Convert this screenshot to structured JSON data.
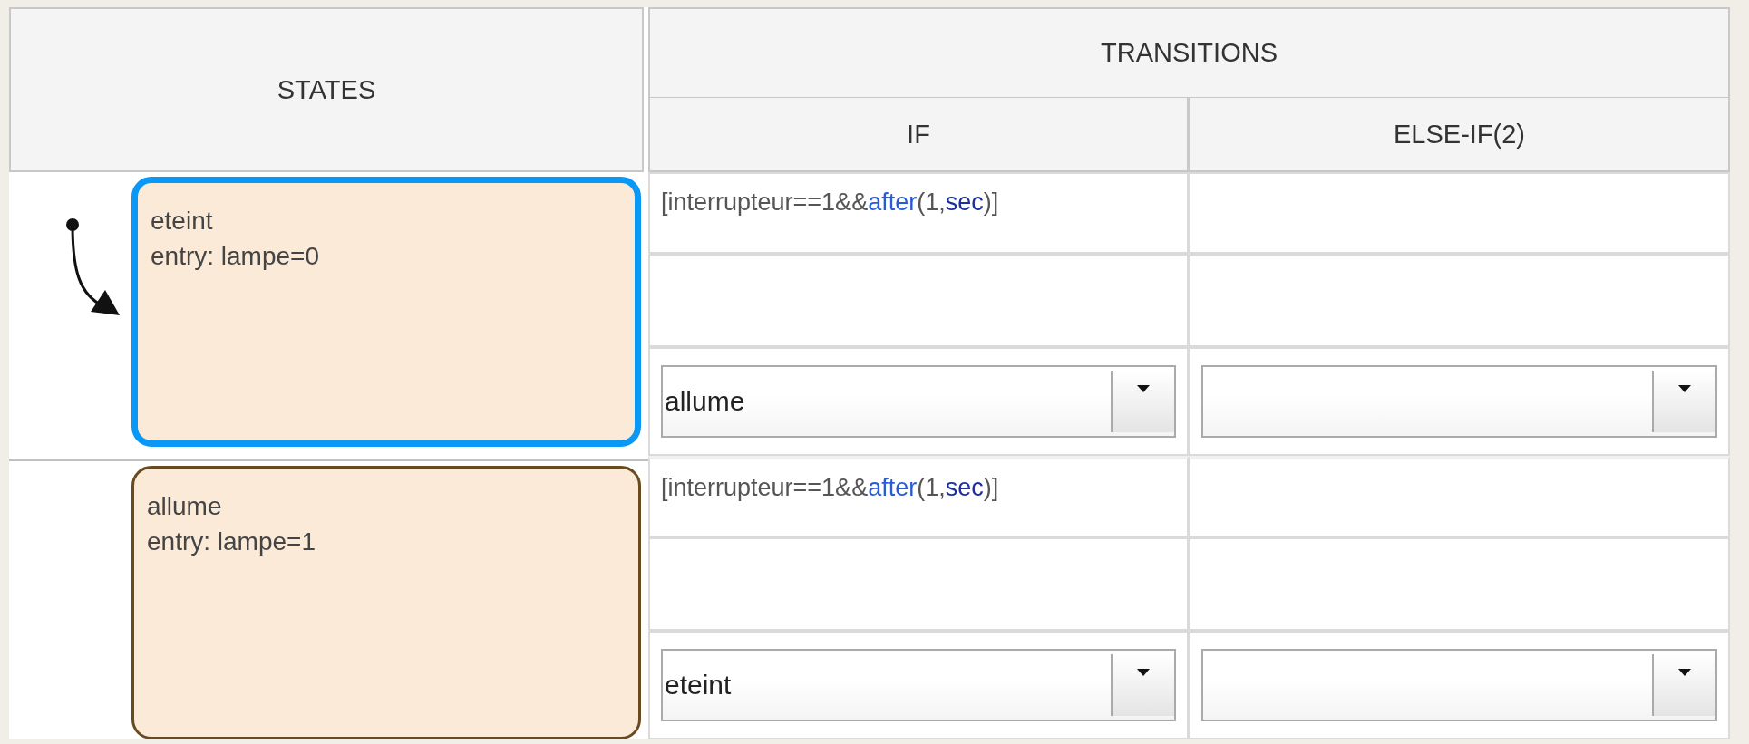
{
  "table": {
    "states_header": "STATES",
    "transitions_header": "TRANSITIONS",
    "columns": [
      "IF",
      "ELSE-IF(2)"
    ],
    "rows": [
      {
        "state": {
          "name": "eteint",
          "entry": "entry: lampe=0",
          "selected": true,
          "default": true
        },
        "if": {
          "condition": [
            {
              "text": "[interrupteur==1&&",
              "kind": "plain"
            },
            {
              "text": "after",
              "kind": "function"
            },
            {
              "text": "(1,",
              "kind": "plain"
            },
            {
              "text": "sec",
              "kind": "keyword"
            },
            {
              "text": ")]",
              "kind": "plain"
            }
          ],
          "destination": "allume"
        }
      },
      {
        "state": {
          "name": "allume",
          "entry": "entry: lampe=1",
          "selected": false,
          "default": false
        },
        "if": {
          "condition": [
            {
              "text": "[interrupteur==1&&",
              "kind": "plain"
            },
            {
              "text": "after",
              "kind": "function"
            },
            {
              "text": "(1,",
              "kind": "plain"
            },
            {
              "text": "sec",
              "kind": "keyword"
            },
            {
              "text": ")]",
              "kind": "plain"
            }
          ],
          "destination": "eteint"
        }
      }
    ]
  }
}
